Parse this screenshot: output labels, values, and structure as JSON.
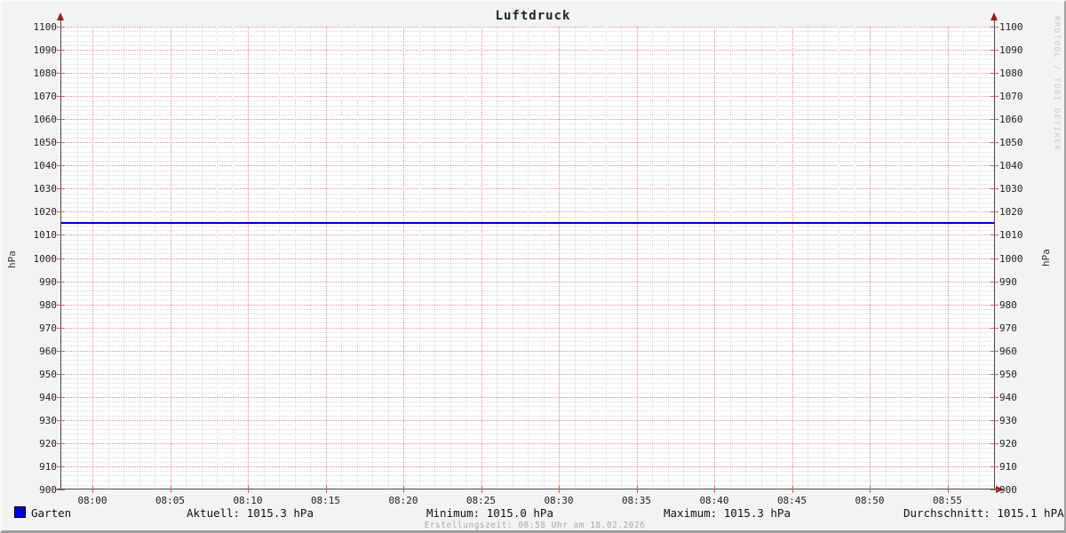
{
  "chart_data": {
    "type": "line",
    "title": "Luftdruck",
    "ylabel_left": "hPa",
    "ylabel_right": "hPa",
    "ylim": [
      900,
      1100
    ],
    "y_major_step": 10,
    "y_minor_step": 2,
    "y_ticks": [
      1100,
      1090,
      1080,
      1070,
      1060,
      1050,
      1040,
      1030,
      1020,
      1010,
      1000,
      990,
      980,
      970,
      960,
      950,
      940,
      930,
      920,
      910,
      900
    ],
    "x_ticks": [
      "08:00",
      "08:05",
      "08:10",
      "08:15",
      "08:20",
      "08:25",
      "08:30",
      "08:35",
      "08:40",
      "08:45",
      "08:50",
      "08:55"
    ],
    "x_window_minutes": 60,
    "x_first_tick_offset_min": 2,
    "x_major_step_min": 5,
    "x_minor_step_min": 1,
    "grid": {
      "on": true,
      "major_color": "#e28f8f",
      "minor_color": "#d9d9d9"
    },
    "legend_position": "bottom",
    "series": [
      {
        "name": "Garten",
        "color": "#0000c0",
        "shape": "constant",
        "value": 1015.3
      }
    ]
  },
  "legend": {
    "series_label": "Garten",
    "aktuell": "Aktuell: 1015.3 hPa",
    "minimum": "Minimum: 1015.0 hPa",
    "maximum": "Maximum: 1015.3 hPa",
    "durchschnitt": "Durchschnitt: 1015.1 hPA"
  },
  "footer": {
    "text": "Erstellungszeit: 08:58 Uhr am 18.02.2026"
  },
  "watermark": "RRDTOOL / TOBI OETIKER"
}
